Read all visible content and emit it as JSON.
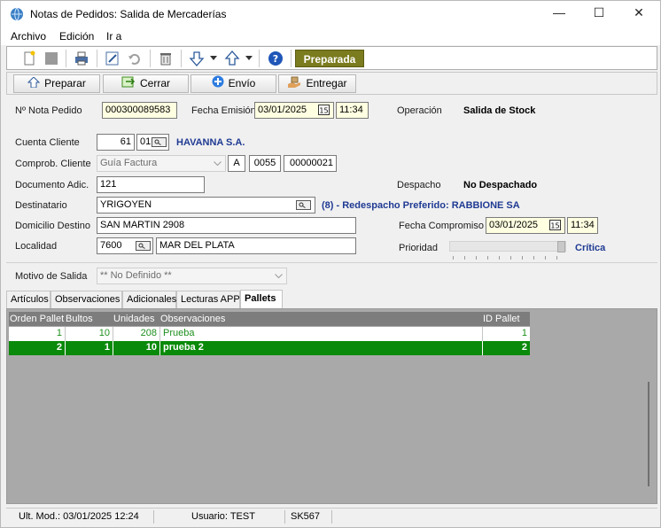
{
  "window": {
    "title": "Notas de Pedidos: Salida de Mercaderías"
  },
  "menu": [
    "Archivo",
    "Edición",
    "Ir a"
  ],
  "toolbar": {
    "status_badge": "Preparada"
  },
  "actions": {
    "preparar": "Preparar",
    "cerrar": "Cerrar",
    "envio": "Envío",
    "entregar": "Entregar"
  },
  "form": {
    "nro_nota_label": "Nº Nota Pedido",
    "nro_nota": "000300089583",
    "fecha_emision_label": "Fecha Emisión",
    "fecha_emision": "03/01/2025",
    "hora_emision": "11:34",
    "operacion_label": "Operación",
    "operacion": "Salida de Stock",
    "cuenta_label": "Cuenta Cliente",
    "cuenta_nro": "61",
    "cuenta_suc": "01",
    "cuenta_nombre": "HAVANNA S.A.",
    "comprob_label": "Comprob. Cliente",
    "comprob_tipo": "Guía Factura",
    "comprob_letra": "A",
    "comprob_pv": "0055",
    "comprob_nro": "00000021",
    "doc_adic_label": "Documento Adic.",
    "doc_adic": "121",
    "despacho_label": "Despacho",
    "despacho": "No Despachado",
    "destinatario_label": "Destinatario",
    "destinatario": "YRIGOYEN",
    "redespacho": "(8) - Redespacho Preferido: RABBIONE SA",
    "domicilio_label": "Domicilio Destino",
    "domicilio": "SAN MARTIN 2908",
    "fecha_comp_label": "Fecha Compromiso",
    "fecha_comp": "03/01/2025",
    "hora_comp": "11:34",
    "localidad_label": "Localidad",
    "localidad_cp": "7600",
    "localidad_nombre": "MAR DEL PLATA",
    "prioridad_label": "Prioridad",
    "prioridad": "Crítica",
    "prioridad_level": 1.0,
    "motivo_label": "Motivo de Salida",
    "motivo": "** No Definido **"
  },
  "tabs": [
    "Artículos",
    "Observaciones",
    "Adicionales",
    "Lecturas APP",
    "Pallets"
  ],
  "grid": {
    "headers": [
      "Orden Pallet",
      "Bultos",
      "Unidades",
      "Observaciones",
      "ID Pallet"
    ],
    "rows": [
      [
        "1",
        "10",
        "208",
        "Prueba",
        "1"
      ],
      [
        "2",
        "1",
        "10",
        "prueba 2",
        "2"
      ]
    ]
  },
  "status": {
    "ult_mod": "Ult. Mod.: 03/01/2025 12:24",
    "usuario": "Usuario: TEST",
    "code": "SK567"
  },
  "colors": {
    "badge": "#7b7b1f",
    "selected_row": "#0a8a0a",
    "row_text": "#1f8f1f",
    "link_blue": "#1f3a93"
  }
}
